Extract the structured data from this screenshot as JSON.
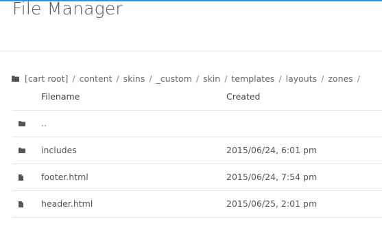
{
  "colors": {
    "accent": "#3d8bd9",
    "icon": "#555555"
  },
  "header": {
    "title": "File Manager"
  },
  "breadcrumb": {
    "icon": "folder-icon",
    "items": [
      "[cart root]",
      "content",
      "skins",
      "_custom",
      "skin",
      "templates",
      "layouts",
      "zones"
    ],
    "separator": "/"
  },
  "table": {
    "columns": {
      "filename": "Filename",
      "created": "Created"
    },
    "rows": [
      {
        "icon": "folder-icon",
        "name": "..",
        "created": ""
      },
      {
        "icon": "folder-icon",
        "name": "includes",
        "created": "2015/06/24, 6:01 pm"
      },
      {
        "icon": "file-icon",
        "name": "footer.html",
        "created": "2015/06/24, 7:54 pm"
      },
      {
        "icon": "file-icon",
        "name": "header.html",
        "created": "2015/06/25, 2:01 pm"
      }
    ]
  }
}
